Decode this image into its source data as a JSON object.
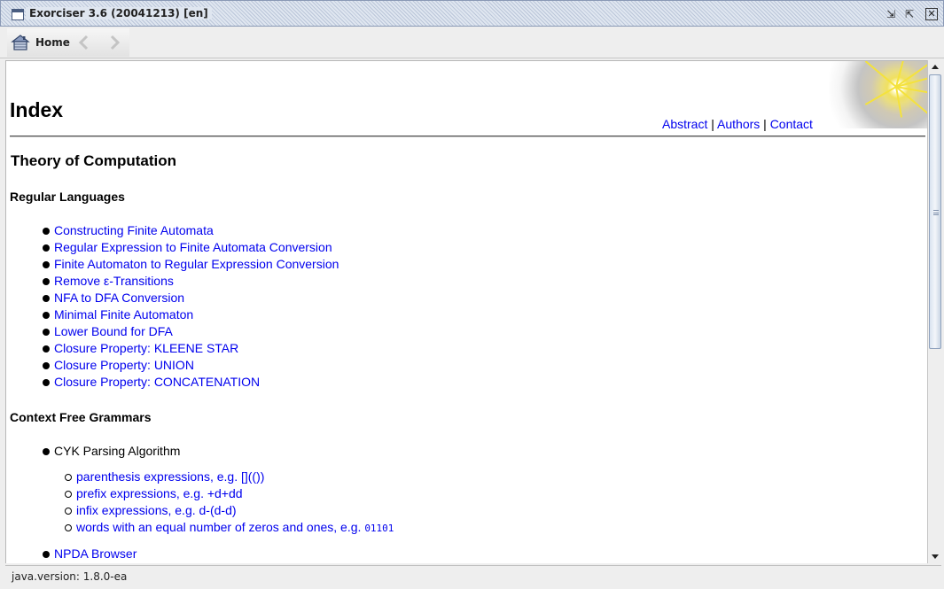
{
  "window": {
    "title": "Exorciser 3.6 (20041213) [en]",
    "minimize_glyph": "⇲",
    "maximize_glyph": "⇱",
    "close_glyph": "✕"
  },
  "toolbar": {
    "home_label": "Home",
    "home_icon": "house-icon",
    "back_icon": "chevron-left-icon",
    "forward_icon": "chevron-right-icon"
  },
  "page": {
    "title": "Index",
    "links": {
      "abstract": "Abstract",
      "authors": "Authors",
      "contact": "Contact",
      "separator": "|"
    },
    "section_title": "Theory of Computation",
    "regular": {
      "heading": "Regular Languages",
      "items": [
        "Constructing Finite Automata",
        "Regular Expression to Finite Automata Conversion",
        "Finite Automaton to Regular Expression Conversion",
        "Remove ε-Transitions",
        "NFA to DFA Conversion",
        "Minimal Finite Automaton",
        "Lower Bound for DFA",
        "Closure Property: KLEENE STAR",
        "Closure Property: UNION",
        "Closure Property: CONCATENATION"
      ]
    },
    "cfg": {
      "heading": "Context Free Grammars",
      "cyk": "CYK Parsing Algorithm",
      "cyk_items": [
        "parenthesis expressions, e.g. [](())",
        "prefix expressions, e.g. +d+dd",
        "infix expressions, e.g. d-(d-d)"
      ],
      "words_item": "words with an equal number of zeros and ones, e.g.",
      "words_example": "01101",
      "npda": "NPDA Browser"
    }
  },
  "status": {
    "text": "java.version: 1.8.0-ea"
  },
  "colors": {
    "link": "#0000ee",
    "titlebar": "#dfe6f0"
  }
}
